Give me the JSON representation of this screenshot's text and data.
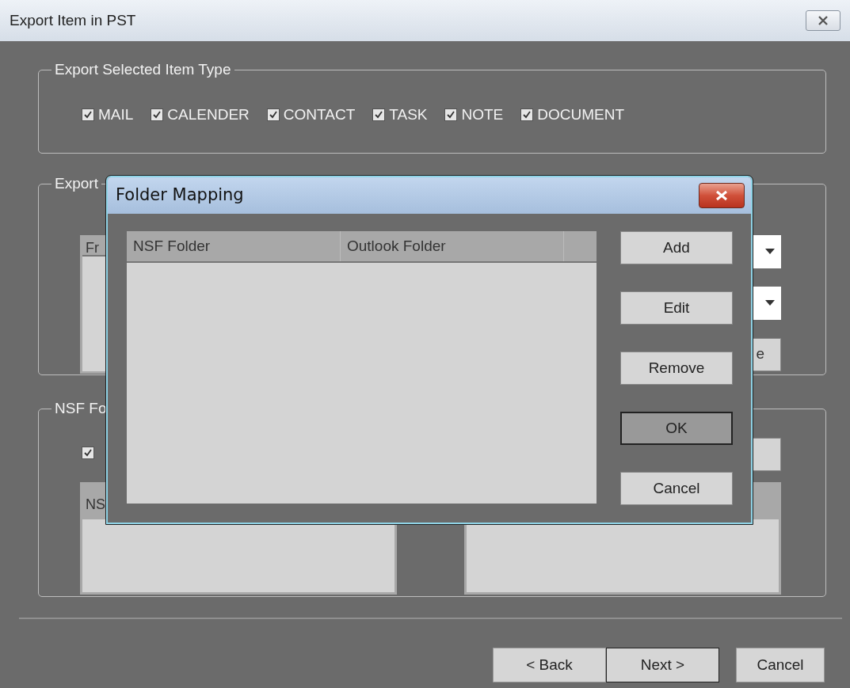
{
  "window": {
    "title": "Export Item in PST"
  },
  "item_type_group": {
    "title": "Export Selected Item Type",
    "items": [
      {
        "label": "MAIL",
        "checked": true
      },
      {
        "label": "CALENDER",
        "checked": true
      },
      {
        "label": "CONTACT",
        "checked": true
      },
      {
        "label": "TASK",
        "checked": true
      },
      {
        "label": "NOTE",
        "checked": true
      },
      {
        "label": "DOCUMENT",
        "checked": true
      }
    ]
  },
  "options_group": {
    "title": "Export",
    "list_header": "Fr",
    "button_label": "e"
  },
  "nsf_group": {
    "title": "NSF Fo",
    "checkbox": {
      "checked": true
    },
    "left_list_header": "NS"
  },
  "buttons": [
    {
      "label": "< Back",
      "default": false
    },
    {
      "label": "Next >",
      "default": true
    },
    {
      "label": "Cancel",
      "default": false
    }
  ],
  "dialog": {
    "title": "Folder Mapping",
    "columns": [
      "NSF Folder",
      "Outlook Folder"
    ],
    "buttons": [
      {
        "label": "Add",
        "default": false
      },
      {
        "label": "Edit",
        "default": false
      },
      {
        "label": "Remove",
        "default": false
      },
      {
        "label": "OK",
        "default": true
      },
      {
        "label": "Cancel",
        "default": false
      }
    ]
  }
}
